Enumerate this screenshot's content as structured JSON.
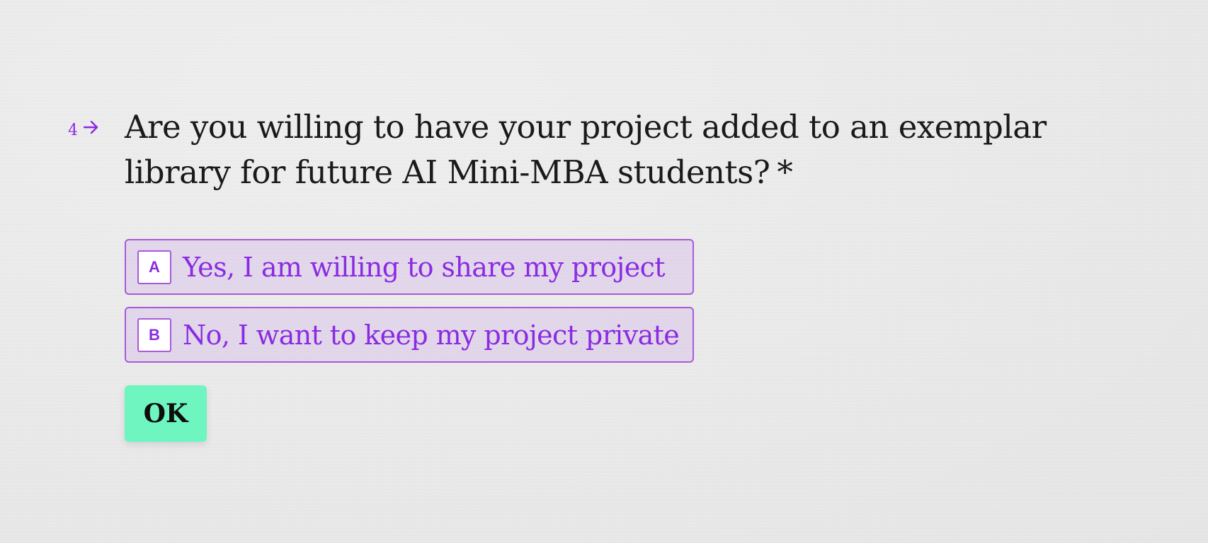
{
  "question": {
    "number": "4",
    "arrow_icon": "arrow-right-icon",
    "text": "Are you willing to have your project added to an exemplar library for future AI Mini-MBA students?",
    "required_marker": "*"
  },
  "choices": [
    {
      "key": "A",
      "label": "Yes, I am willing to share my project"
    },
    {
      "key": "B",
      "label": "No, I want to keep my project private"
    }
  ],
  "ok_button": {
    "label": "OK"
  },
  "colors": {
    "accent": "#8a2be2",
    "choice_border": "#a85ad8",
    "choice_background": "#e6d3ee",
    "ok_background": "#6ff5c0",
    "page_background": "#ebebeb",
    "text": "#1a1a1a"
  }
}
